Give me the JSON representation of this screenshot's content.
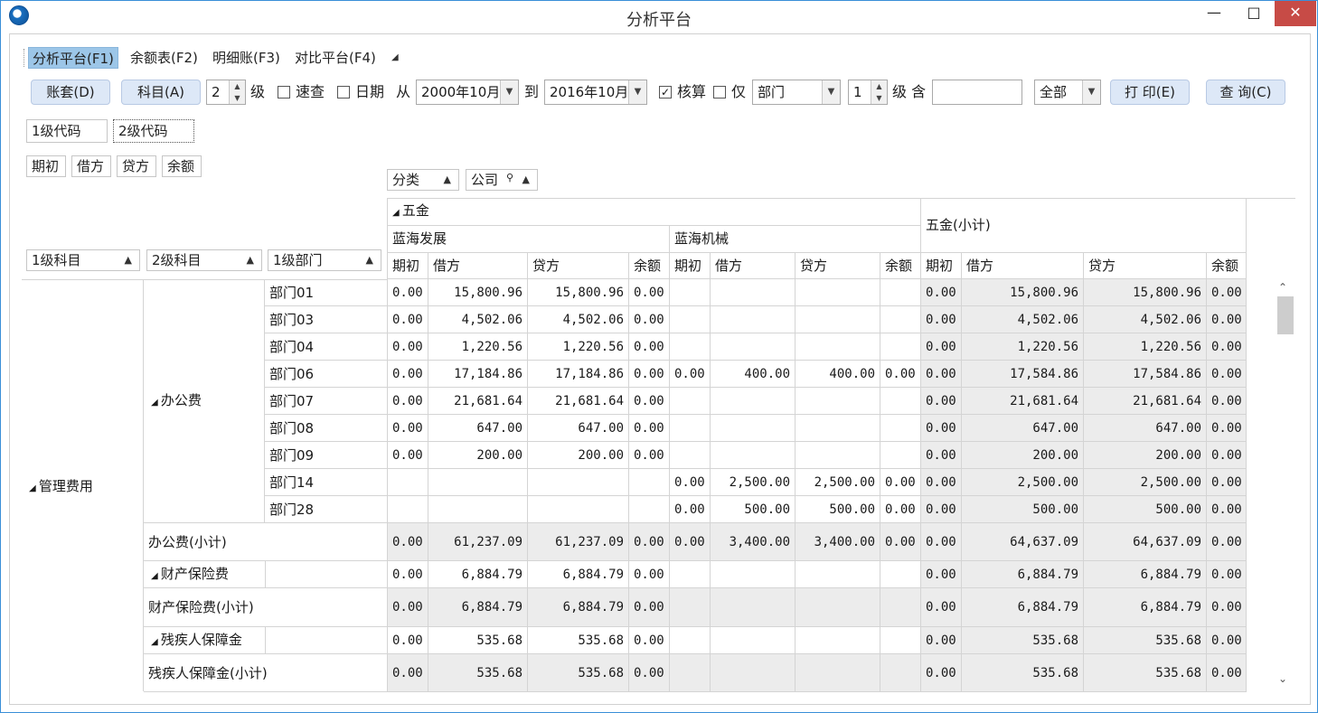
{
  "window": {
    "title": "分析平台",
    "min_glyph": "—",
    "max_glyph": "□",
    "close_glyph": "✕"
  },
  "menu": [
    "分析平台(F1)",
    "余额表(F2)",
    "明细账(F3)",
    "对比平台(F4)"
  ],
  "menu_more_glyph": "◢",
  "toolbar": {
    "book_btn": "账套(D)",
    "subject_btn": "科目(A)",
    "level_value": "2",
    "level_label": "级",
    "quick_label": "速查",
    "date_label": "日期",
    "from_label": "从",
    "from_value": "2000年10月",
    "to_label": "到",
    "to_value": "2016年10月",
    "check_label": "核算",
    "check_mark": "✓",
    "only_label": "仅",
    "dept_value": "部门",
    "dept_level_value": "1",
    "include_label": "级 含",
    "include_value": "",
    "scope_value": "全部",
    "print_btn": "打 印(E)",
    "query_btn": "查 询(C)"
  },
  "code_buttons": [
    "1级代码",
    "2级代码"
  ],
  "measure_fields": [
    "期初",
    "借方",
    "贷方",
    "余额"
  ],
  "column_fields": [
    "分类",
    "公司"
  ],
  "row_fields": [
    "1级科目",
    "2级科目",
    "1级部门"
  ],
  "grid": {
    "category": "五金",
    "companies": [
      "蓝海发展",
      "蓝海机械"
    ],
    "subtotal_header": "五金(小计)",
    "measures": [
      "期初",
      "借方",
      "贷方",
      "余额"
    ],
    "l1_subject": "管理费用",
    "l2_office": "办公费",
    "rows": [
      {
        "dept": "部门01",
        "v": [
          "0.00",
          "15,800.96",
          "15,800.96",
          "0.00",
          "",
          "",
          "",
          "",
          "0.00",
          "15,800.96",
          "15,800.96",
          "0.00"
        ]
      },
      {
        "dept": "部门03",
        "v": [
          "0.00",
          "4,502.06",
          "4,502.06",
          "0.00",
          "",
          "",
          "",
          "",
          "0.00",
          "4,502.06",
          "4,502.06",
          "0.00"
        ]
      },
      {
        "dept": "部门04",
        "v": [
          "0.00",
          "1,220.56",
          "1,220.56",
          "0.00",
          "",
          "",
          "",
          "",
          "0.00",
          "1,220.56",
          "1,220.56",
          "0.00"
        ]
      },
      {
        "dept": "部门06",
        "v": [
          "0.00",
          "17,184.86",
          "17,184.86",
          "0.00",
          "0.00",
          "400.00",
          "400.00",
          "0.00",
          "0.00",
          "17,584.86",
          "17,584.86",
          "0.00"
        ]
      },
      {
        "dept": "部门07",
        "v": [
          "0.00",
          "21,681.64",
          "21,681.64",
          "0.00",
          "",
          "",
          "",
          "",
          "0.00",
          "21,681.64",
          "21,681.64",
          "0.00"
        ]
      },
      {
        "dept": "部门08",
        "v": [
          "0.00",
          "647.00",
          "647.00",
          "0.00",
          "",
          "",
          "",
          "",
          "0.00",
          "647.00",
          "647.00",
          "0.00"
        ]
      },
      {
        "dept": "部门09",
        "v": [
          "0.00",
          "200.00",
          "200.00",
          "0.00",
          "",
          "",
          "",
          "",
          "0.00",
          "200.00",
          "200.00",
          "0.00"
        ]
      },
      {
        "dept": "部门14",
        "v": [
          "",
          "",
          "",
          "",
          "0.00",
          "2,500.00",
          "2,500.00",
          "0.00",
          "0.00",
          "2,500.00",
          "2,500.00",
          "0.00"
        ]
      },
      {
        "dept": "部门28",
        "v": [
          "",
          "",
          "",
          "",
          "0.00",
          "500.00",
          "500.00",
          "0.00",
          "0.00",
          "500.00",
          "500.00",
          "0.00"
        ]
      }
    ],
    "office_subtotal": {
      "label": "办公费(小计)",
      "v": [
        "0.00",
        "61,237.09",
        "61,237.09",
        "0.00",
        "0.00",
        "3,400.00",
        "3,400.00",
        "0.00",
        "0.00",
        "64,637.09",
        "64,637.09",
        "0.00"
      ]
    },
    "insurance": {
      "label": "财产保险费",
      "v": [
        "0.00",
        "6,884.79",
        "6,884.79",
        "0.00",
        "",
        "",
        "",
        "",
        "0.00",
        "6,884.79",
        "6,884.79",
        "0.00"
      ]
    },
    "insurance_subtotal": {
      "label": "财产保险费(小计)",
      "v": [
        "0.00",
        "6,884.79",
        "6,884.79",
        "0.00",
        "",
        "",
        "",
        "",
        "0.00",
        "6,884.79",
        "6,884.79",
        "0.00"
      ]
    },
    "disabled": {
      "label": "残疾人保障金",
      "v": [
        "0.00",
        "535.68",
        "535.68",
        "0.00",
        "",
        "",
        "",
        "",
        "0.00",
        "535.68",
        "535.68",
        "0.00"
      ]
    },
    "disabled_subtotal": {
      "label": "残疾人保障金(小计)",
      "v": [
        "0.00",
        "535.68",
        "535.68",
        "0.00",
        "",
        "",
        "",
        "",
        "0.00",
        "535.68",
        "535.68",
        "0.00"
      ]
    }
  }
}
